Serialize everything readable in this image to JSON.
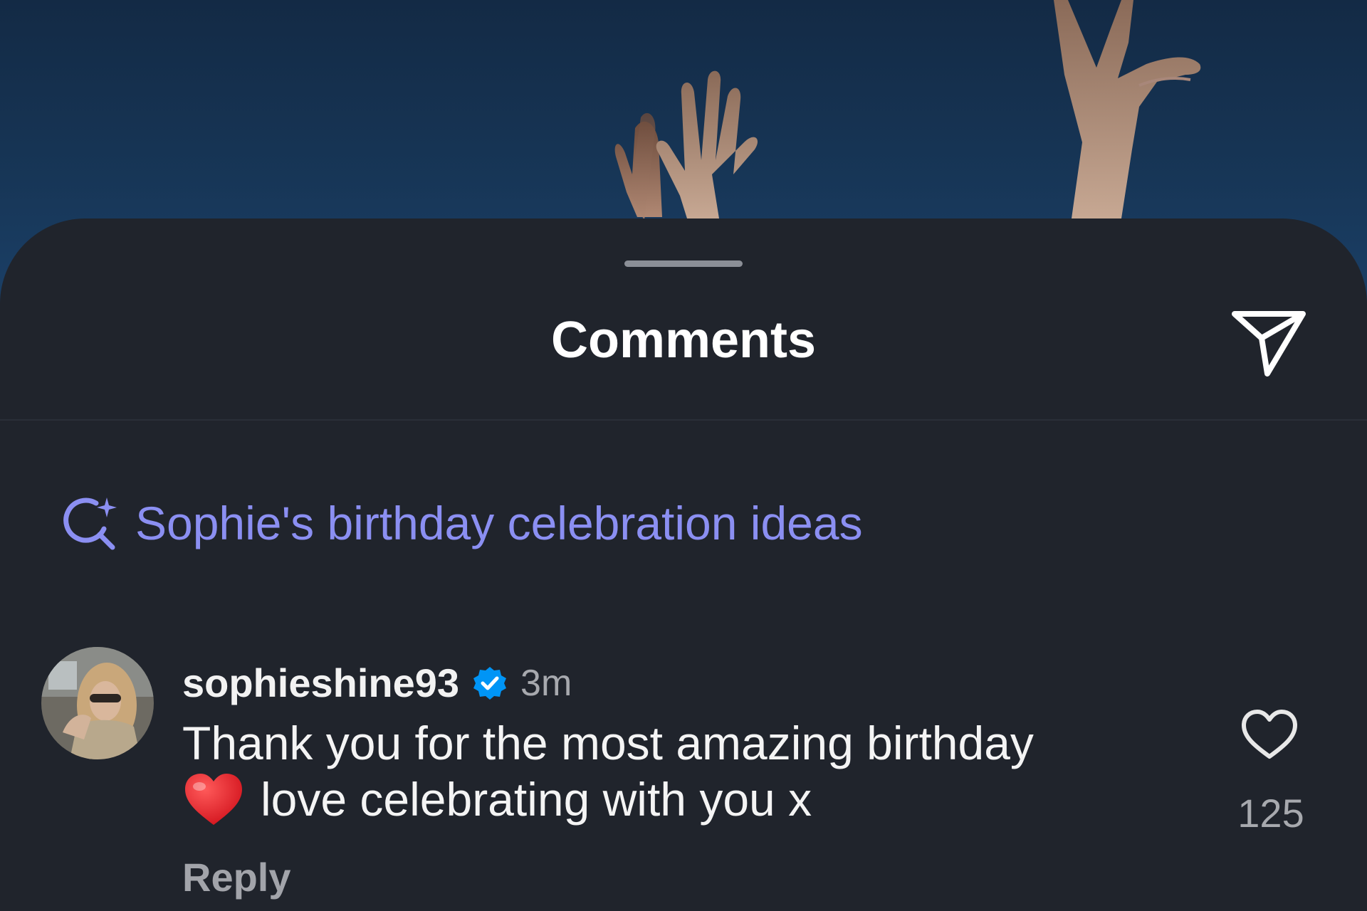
{
  "sheet": {
    "title": "Comments"
  },
  "suggestion": {
    "text": "Sophie's birthday celebration ideas",
    "icon": "ai-search-sparkle-icon",
    "color": "#8b8ff2"
  },
  "comment": {
    "username": "sophieshine93",
    "verified": true,
    "timestamp": "3m",
    "text_line1": "Thank you for the most amazing birthday",
    "text_line2": "love celebrating with you x",
    "emoji": "red-heart",
    "reply_label": "Reply",
    "likes": "125"
  },
  "colors": {
    "sheet_bg": "#20242c",
    "accent_blue": "#0095f6",
    "muted_text": "#a7a9ae"
  }
}
